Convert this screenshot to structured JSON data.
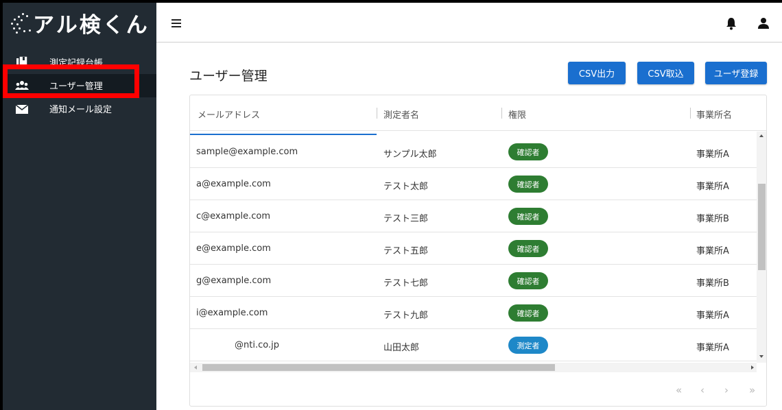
{
  "app": {
    "logo_text": "アル検くん"
  },
  "sidebar": {
    "items": [
      {
        "label": "測定記録台帳",
        "icon": "book-icon"
      },
      {
        "label": "ユーザー管理",
        "icon": "users-icon"
      },
      {
        "label": "通知メール設定",
        "icon": "mail-icon"
      }
    ]
  },
  "header": {
    "menu_icon": "hamburger-icon",
    "bell_icon": "bell-icon",
    "user_icon": "user-icon"
  },
  "main": {
    "title": "ユーザー管理",
    "buttons": {
      "csv_export": "CSV出力",
      "csv_import": "CSV取込",
      "register": "ユーザ登録"
    },
    "table": {
      "columns": [
        "メールアドレス",
        "測定者名",
        "権限",
        "事業所名"
      ],
      "rows": [
        {
          "email": "sample@example.com",
          "name": "サンプル太郎",
          "role": "確認者",
          "office": "事業所A"
        },
        {
          "email": "a@example.com",
          "name": "テスト太郎",
          "role": "確認者",
          "office": "事業所A"
        },
        {
          "email": "c@example.com",
          "name": "テスト三郎",
          "role": "確認者",
          "office": "事業所B"
        },
        {
          "email": "e@example.com",
          "name": "テスト五郎",
          "role": "確認者",
          "office": "事業所A"
        },
        {
          "email": "g@example.com",
          "name": "テスト七郎",
          "role": "確認者",
          "office": "事業所B"
        },
        {
          "email": "i@example.com",
          "name": "テスト九郎",
          "role": "確認者",
          "office": "事業所A"
        },
        {
          "email": "@nti.co.jp",
          "name": "山田太郎",
          "role": "測定者",
          "office": "事業所A"
        }
      ]
    },
    "pagination": {
      "first": "«",
      "prev": "‹",
      "next": "›",
      "last": "»"
    }
  },
  "colors": {
    "sidebar_bg": "#222b33",
    "primary": "#1a6fcf",
    "role_confirmer": "#2e7d32",
    "role_measurer": "#1e88c8",
    "highlight": "#ff0000"
  }
}
